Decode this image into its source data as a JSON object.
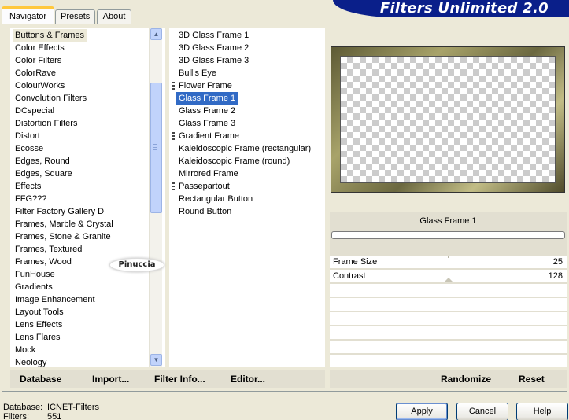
{
  "tabs": [
    "Navigator",
    "Presets",
    "About"
  ],
  "banner_title": "Filters Unlimited 2.0",
  "categories": [
    "Buttons & Frames",
    "Color Effects",
    "Color Filters",
    "ColorRave",
    "ColourWorks",
    "Convolution Filters",
    "DCspecial",
    "Distortion Filters",
    "Distort",
    "Ecosse",
    "Edges, Round",
    "Edges, Square",
    "Effects",
    "FFG???",
    "Filter Factory Gallery D",
    "Frames, Marble & Crystal",
    "Frames, Stone & Granite",
    "Frames, Textured",
    "Frames, Wood",
    "FunHouse",
    "Gradients",
    "Image Enhancement",
    "Layout Tools",
    "Lens Effects",
    "Lens Flares",
    "Mock",
    "Neology"
  ],
  "filters": [
    "3D Glass Frame 1",
    "3D Glass Frame 2",
    "3D Glass Frame 3",
    "Bull's Eye",
    "Flower Frame",
    "Glass Frame 1",
    "Glass Frame 2",
    "Glass Frame 3",
    "Gradient Frame",
    "Kaleidoscopic Frame (rectangular)",
    "Kaleidoscopic Frame (round)",
    "Mirrored Frame",
    "Passepartout",
    "Rectangular Button",
    "Round Button"
  ],
  "selected_filter": "Glass Frame 1",
  "watermark": "Pinuccia",
  "params": [
    {
      "label": "Frame Size",
      "value": "25"
    },
    {
      "label": "Contrast",
      "value": "128"
    }
  ],
  "toolbar": {
    "database": "Database",
    "import": "Import...",
    "filter_info": "Filter Info...",
    "editor": "Editor...",
    "randomize": "Randomize",
    "reset": "Reset"
  },
  "footer": {
    "database_label": "Database:",
    "database_value": "ICNET-Filters",
    "filters_label": "Filters:",
    "filters_value": "551",
    "apply": "Apply",
    "cancel": "Cancel",
    "help": "Help"
  },
  "colors": {
    "selection": "#316ac5",
    "banner": "#0a1f8a",
    "tab_accent": "#ffc83c"
  }
}
